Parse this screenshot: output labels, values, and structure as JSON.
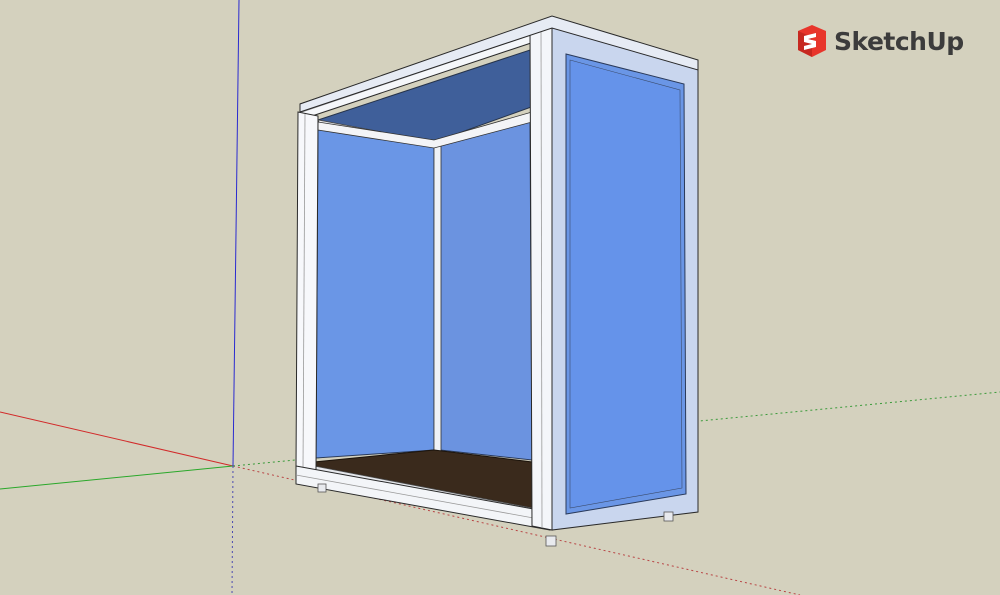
{
  "app": {
    "brand_name": "SketchUp",
    "logo_icon": "sketchup-logo-icon",
    "brand_color": "#e8352b"
  },
  "scene": {
    "background_color": "#d4d1be",
    "axis_colors": {
      "red": "#d22a2a",
      "green": "#2aa82a",
      "blue": "#2a2ad0"
    },
    "glass_color": "#6a96e6",
    "frame_color": "#f4f6fa",
    "floor_color": "#3a2a1c"
  }
}
